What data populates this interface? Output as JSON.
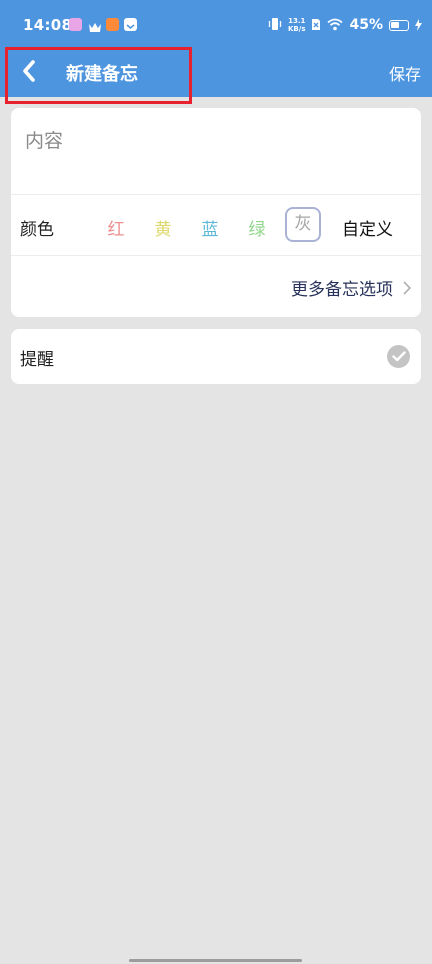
{
  "status_bar": {
    "time": "14:08",
    "net_speed_value": "13.1",
    "net_speed_unit": "KB/s",
    "battery": "45%"
  },
  "header": {
    "title": "新建备忘",
    "save_label": "保存",
    "bg_color": "#4e95e0",
    "highlight_color": "#e8212e"
  },
  "note": {
    "content_placeholder": "内容",
    "color_label": "颜色",
    "colors": [
      {
        "label": "红",
        "color": "#ee8f8f",
        "selected": false
      },
      {
        "label": "黄",
        "color": "#ddd86a",
        "selected": false
      },
      {
        "label": "蓝",
        "color": "#5db8d8",
        "selected": false
      },
      {
        "label": "绿",
        "color": "#8fd68a",
        "selected": false
      },
      {
        "label": "灰",
        "color": "#a6a6a6",
        "selected": true
      }
    ],
    "custom_color_label": "自定义",
    "more_options_label": "更多备忘选项"
  },
  "reminder": {
    "label": "提醒",
    "checked": true
  }
}
